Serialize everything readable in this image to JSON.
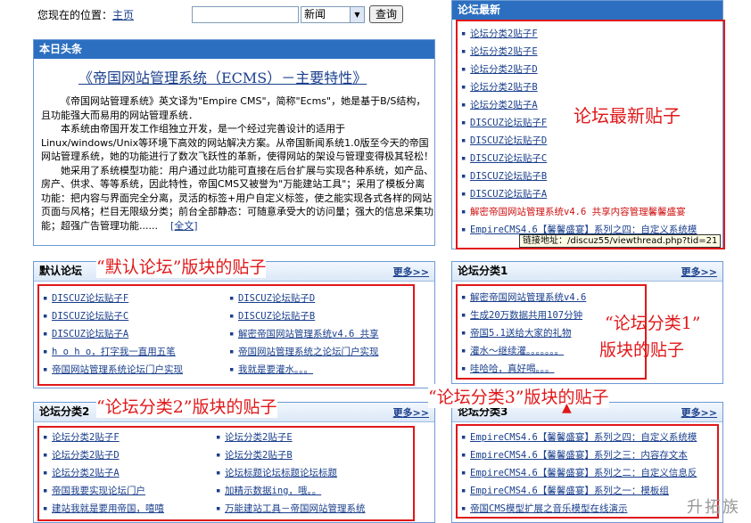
{
  "topbar": {
    "location_label": "您现在的位置：",
    "location_link": "主页",
    "search_value": "",
    "select_value": "新闻",
    "query_button": "查询"
  },
  "headline_box": {
    "title": "本日头条",
    "headline": "《帝国网站管理系统（ECMS）－主要特性》",
    "paragraphs": [
      "《帝国网站管理系统》英文译为\"Empire CMS\"，简称\"Ecms\"，她是基于B/S结构，且功能强大而易用的网站管理系统．",
      "本系统由帝国开发工作组独立开发，是一个经过完善设计的适用于Linux/windows/Unix等环境下高效的网站解决方案。从帝国新闻系统1.0版至今天的帝国网站管理系统，她的功能进行了数次飞跃性的革新，使得网站的架设与管理变得极其轻松！",
      "她采用了系统模型功能：用户通过此功能可直接在后台扩展与实现各种系统，如产品、房产、供求、等等系统，因此特性，帝国CMS又被誉为\"万能建站工具\"；采用了模板分离功能：把内容与界面完全分离，灵活的标签+用户自定义标签，使之能实现各式各样的网站页面与风格；栏目无限级分类；前台全部静态：可随意承受大的访问量；强大的信息采集功能；超强广告管理功能......"
    ],
    "full_link": "[全文]"
  },
  "forum_latest": {
    "title": "论坛最新",
    "items": [
      {
        "text": "论坛分类2贴子F"
      },
      {
        "text": "论坛分类2贴子E"
      },
      {
        "text": "论坛分类2贴子D"
      },
      {
        "text": "论坛分类2贴子B"
      },
      {
        "text": "论坛分类2贴子A"
      },
      {
        "text": "DISCUZ论坛贴子F"
      },
      {
        "text": "DISCUZ论坛贴子D"
      },
      {
        "text": "DISCUZ论坛贴子C"
      },
      {
        "text": "DISCUZ论坛贴子B"
      },
      {
        "text": "DISCUZ论坛贴子A"
      },
      {
        "text": "解密帝国网站管理系统v4.6 共享内容管理馨馨盛宴"
      },
      {
        "text": "EmpireCMS4.6【馨馨盛宴】系列之四：自定义系统模"
      }
    ],
    "tooltip": "链接地址：/discuz55/viewthread.php?tid=21",
    "note": "论坛最新贴子"
  },
  "default_forum": {
    "title": "默认论坛",
    "more": "更多>>",
    "col1": [
      "DISCUZ论坛贴子F",
      "DISCUZ论坛贴子C",
      "DISCUZ论坛贴子A",
      "h o h o，打字我一直用五笔",
      "帝国网站管理系统论坛门户实现"
    ],
    "col2": [
      "DISCUZ论坛贴子D",
      "DISCUZ论坛贴子B",
      "解密帝国网站管理系统v4.6 共享",
      "帝国网站管理系统之论坛门户实现",
      "我就是要灌水。。。"
    ],
    "note": "“默认论坛”版块的贴子"
  },
  "forum_cat1": {
    "title": "论坛分类1",
    "more": "更多>>",
    "items": [
      "解密帝国网站管理系统v4.6",
      "生成20万数据共用107分钟",
      "帝国5.1送给大家的礼物",
      "灌水～继续灌。。。。。。。",
      "哇哈哈，真好喝。。。"
    ],
    "note1": "“论坛分类1”",
    "note2": "版块的贴子"
  },
  "forum_cat2": {
    "title": "论坛分类2",
    "more": "更多>>",
    "col1": [
      "论坛分类2贴子F",
      "论坛分类2贴子D",
      "论坛分类2贴子A",
      "帝国我要实现论坛门户",
      "建站我就是要用帝国，嘻嘻"
    ],
    "col2": [
      "论坛分类2贴子E",
      "论坛分类2贴子B",
      "论坛标题论坛标题论坛标题",
      "加精示数据ing，哦。。",
      "万能建站工具－帝国网站管理系统"
    ],
    "note": "“论坛分类2”版块的贴子"
  },
  "forum_cat3": {
    "title": "论坛分类3",
    "more": "更多>>",
    "items": [
      "EmpireCMS4.6【馨馨盛宴】系列之四：自定义系统模",
      "EmpireCMS4.6【馨馨盛宴】系列之三：内容存文本",
      "EmpireCMS4.6【馨馨盛宴】系列之二：自定义信息反",
      "EmpireCMS4.6【馨馨盛宴】系列之一：模板组",
      "帝国CMS模型扩展之音乐模型在线演示"
    ],
    "note": "“论坛分类3”版块的贴子"
  },
  "watermark": "升拓族"
}
